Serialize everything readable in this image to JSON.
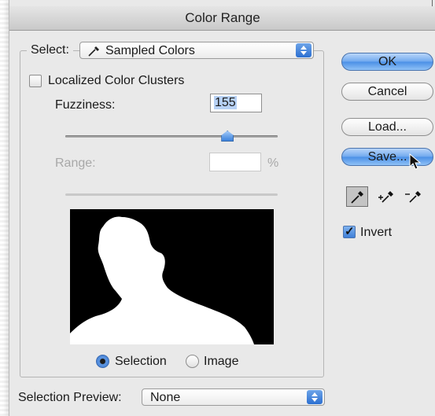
{
  "window": {
    "title": "Color Range"
  },
  "select": {
    "label": "Select:",
    "value": "Sampled Colors",
    "icon": "eyedropper-icon"
  },
  "localized": {
    "label": "Localized Color Clusters",
    "checked": false
  },
  "fuzziness": {
    "label": "Fuzziness:",
    "value": "155",
    "slider_fraction": 0.76
  },
  "range": {
    "label": "Range:",
    "value": "",
    "unit": "%",
    "enabled": false
  },
  "preview_mode": {
    "selection_label": "Selection",
    "image_label": "Image",
    "selected": "Selection"
  },
  "selection_preview": {
    "label": "Selection Preview:",
    "value": "None"
  },
  "buttons": {
    "ok": "OK",
    "cancel": "Cancel",
    "load": "Load...",
    "save": "Save..."
  },
  "tools": [
    "eyedropper-icon",
    "eyedropper-plus-icon",
    "eyedropper-minus-icon"
  ],
  "invert": {
    "label": "Invert",
    "checked": true
  },
  "colors": {
    "accent": "#3f7fd8",
    "dialog_bg": "#e9e9e9"
  }
}
